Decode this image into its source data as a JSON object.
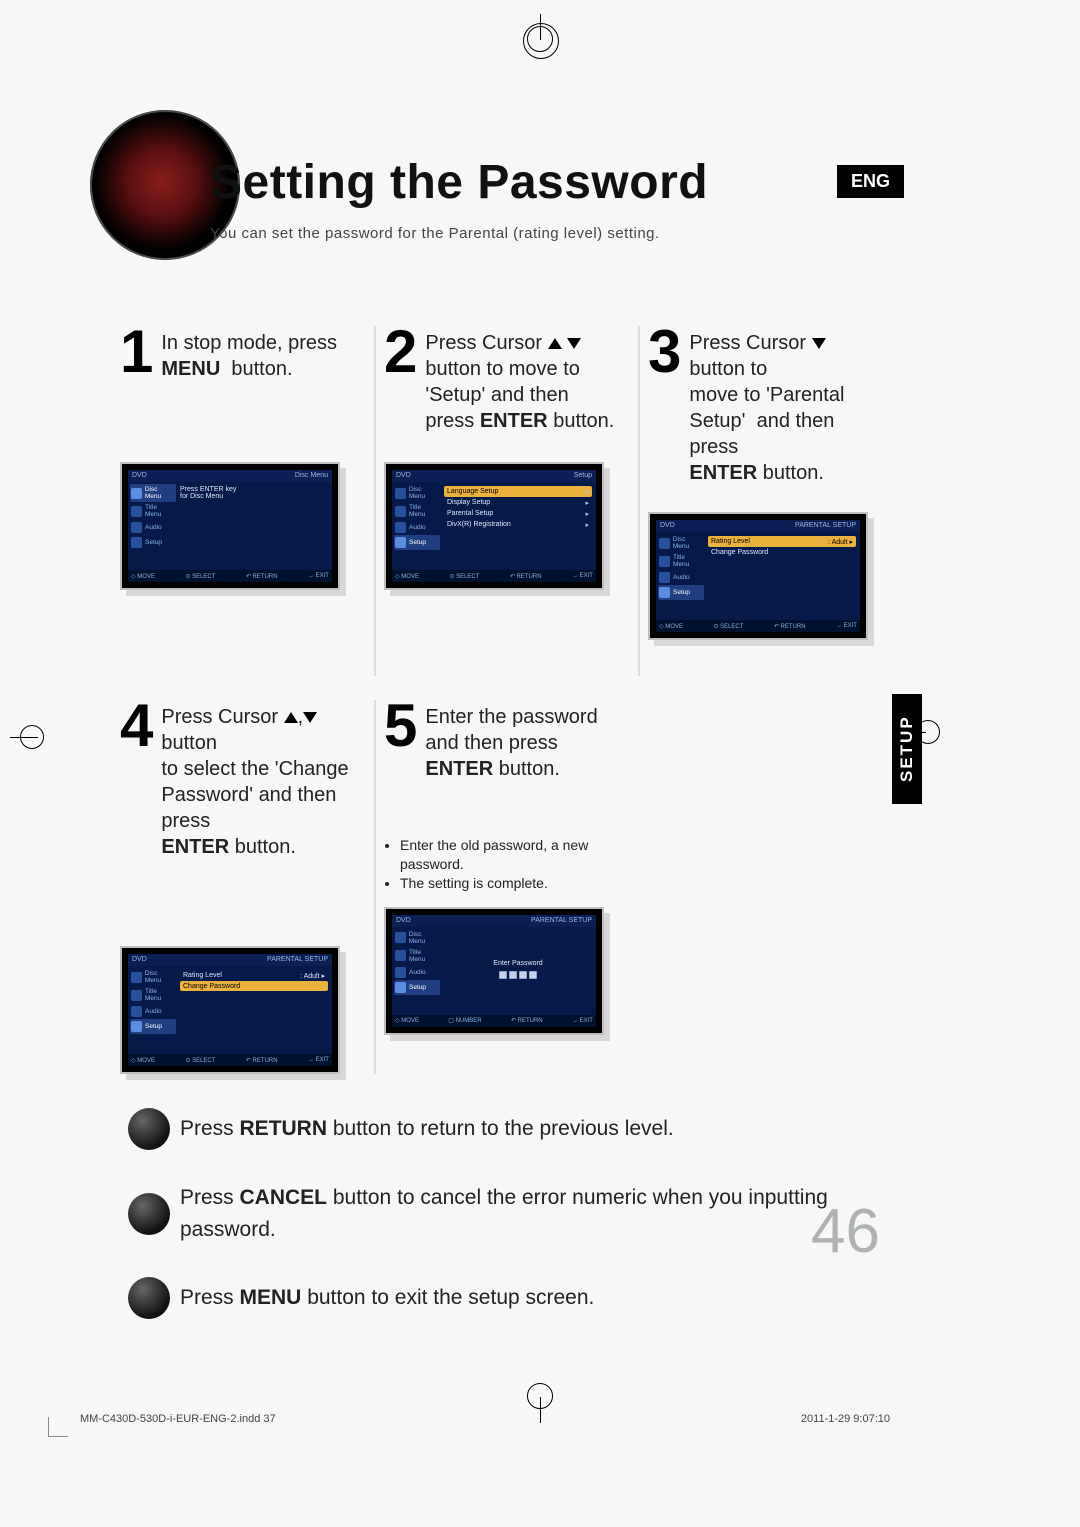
{
  "header": {
    "title": "Setting the Password",
    "subtitle": "You can set the password for the Parental (rating level) setting.",
    "lang_badge": "ENG"
  },
  "side_tab": "SETUP",
  "page_number": "46",
  "print_footer": {
    "left": "MM-C430D-530D-i-EUR-ENG-2.indd   37",
    "right": "2011-1-29   9:07:10"
  },
  "steps": [
    {
      "num": "1",
      "lines": [
        "In stop mode, press",
        "MENU  button."
      ],
      "bold_words": [
        "MENU"
      ],
      "cursor": ""
    },
    {
      "num": "2",
      "lines": [
        "Press Cursor ",
        "button to move to",
        "'Setup' and then",
        "press ENTER button."
      ],
      "bold_words": [
        "ENTER"
      ],
      "cursor": "updown"
    },
    {
      "num": "3",
      "lines": [
        "Press Cursor  button to",
        "move to 'Parental",
        "Setup'  and then press",
        "ENTER button."
      ],
      "bold_words": [
        "ENTER"
      ],
      "cursor": "down"
    },
    {
      "num": "4",
      "lines": [
        "Press Cursor  ,  button",
        "to select the 'Change",
        "Password' and then press",
        "ENTER button."
      ],
      "bold_words": [
        "ENTER"
      ],
      "cursor": "up_down_sep"
    },
    {
      "num": "5",
      "lines": [
        "Enter the password",
        "and then press",
        "ENTER button."
      ],
      "bold_words": [
        "ENTER"
      ],
      "cursor": ""
    }
  ],
  "step5_notes": [
    "Enter the old password, a new password.",
    "The setting is complete."
  ],
  "osd_common": {
    "top_left": "DVD",
    "footer_move": "MOVE",
    "footer_select": "SELECT",
    "footer_return": "RETURN",
    "footer_exit": "EXIT",
    "footer_number": "NUMBER"
  },
  "osd1": {
    "top_right": "Disc Menu",
    "side": [
      "Disc Menu",
      "Title Menu",
      "Audio",
      "Setup"
    ],
    "active_side": 0,
    "main_lines": [
      "Press ENTER key",
      "for Disc Menu"
    ]
  },
  "osd2": {
    "top_right": "Setup",
    "side": [
      "Disc Menu",
      "Title Menu",
      "Audio",
      "Setup"
    ],
    "active_side": 3,
    "main_lines": [
      "Language Setup",
      "Display Setup",
      "Parental Setup",
      "DivX(R) Registration"
    ],
    "hl_index": 0
  },
  "osd3": {
    "top_right": "PARENTAL SETUP",
    "side": [
      "Disc Menu",
      "Title Menu",
      "Audio",
      "Setup"
    ],
    "active_side": 3,
    "rows": [
      {
        "label": "Rating Level",
        "value": "Adult",
        "hl": true
      },
      {
        "label": "Change Password",
        "value": "",
        "hl": false
      }
    ]
  },
  "osd4": {
    "top_right": "PARENTAL SETUP",
    "side": [
      "Disc Menu",
      "Title Menu",
      "Audio",
      "Setup"
    ],
    "active_side": 3,
    "rows": [
      {
        "label": "Rating Level",
        "value": "Adult",
        "hl": false
      },
      {
        "label": "Change Password",
        "value": "",
        "hl": true
      }
    ]
  },
  "osd5": {
    "top_right": "PARENTAL SETUP",
    "side": [
      "Disc Menu",
      "Title Menu",
      "Audio",
      "Setup"
    ],
    "active_side": 3,
    "center_label": "Enter Password"
  },
  "footer_lines": [
    {
      "pre": "Press ",
      "bold": "RETURN",
      "post": " button to return to the previous level."
    },
    {
      "pre": "Press ",
      "bold": "CANCEL",
      "post": " button to cancel the error numeric when you inputting password."
    },
    {
      "pre": "Press ",
      "bold": "MENU",
      "post": " button to exit the setup screen."
    }
  ]
}
